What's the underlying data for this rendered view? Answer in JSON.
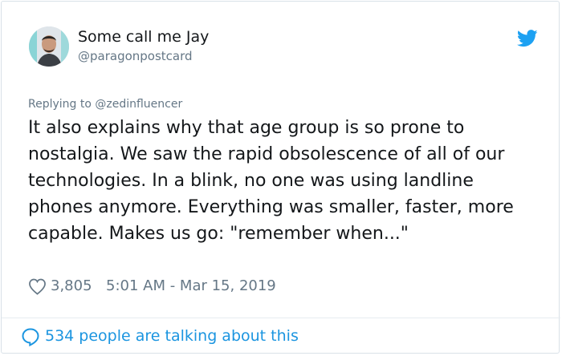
{
  "author": {
    "name": "Some call me Jay",
    "handle": "@paragonpostcard"
  },
  "icons": {
    "brand": "twitter-bird-icon",
    "like": "heart-icon",
    "conversation": "comment-bubble-icon"
  },
  "tweet": {
    "reply_context": "Replying to @zedinfluencer",
    "text": "It also explains why that age group is so prone to nostalgia. We saw the rapid obsolescence of all of our technologies. In a blink, no one was using landline phones anymore. Everything was smaller, faster, more capable. Makes us go: \"remember when...\"",
    "likes": "3,805",
    "timestamp": "5:01 AM - Mar 15, 2019"
  },
  "footer": {
    "conversation_label": "534 people are talking about this"
  },
  "colors": {
    "brand_blue": "#1da1f2",
    "link_blue": "#1b95e0",
    "text": "#14171a",
    "muted": "#657786",
    "border": "#d9e1e8"
  }
}
